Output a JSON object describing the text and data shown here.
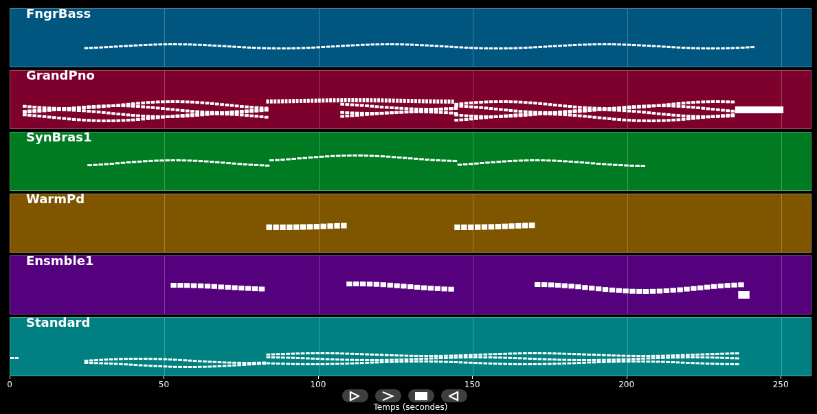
{
  "tracks": [
    {
      "name": "FngrBass",
      "color": "#00567f"
    },
    {
      "name": "GrandPno",
      "color": "#7d002d"
    },
    {
      "name": "SynBras1",
      "color": "#007b22"
    },
    {
      "name": "WarmPd",
      "color": "#805500"
    },
    {
      "name": "Ensmble1",
      "color": "#55007d"
    },
    {
      "name": "Standard",
      "color": "#008080"
    }
  ],
  "x_axis": {
    "ticks": [
      "0",
      "50",
      "100",
      "150",
      "200",
      "250"
    ],
    "label": "Temps (secondes)"
  },
  "controls": [
    {
      "kind": "play"
    },
    {
      "kind": "forward"
    },
    {
      "kind": "stop"
    },
    {
      "kind": "back"
    }
  ]
}
